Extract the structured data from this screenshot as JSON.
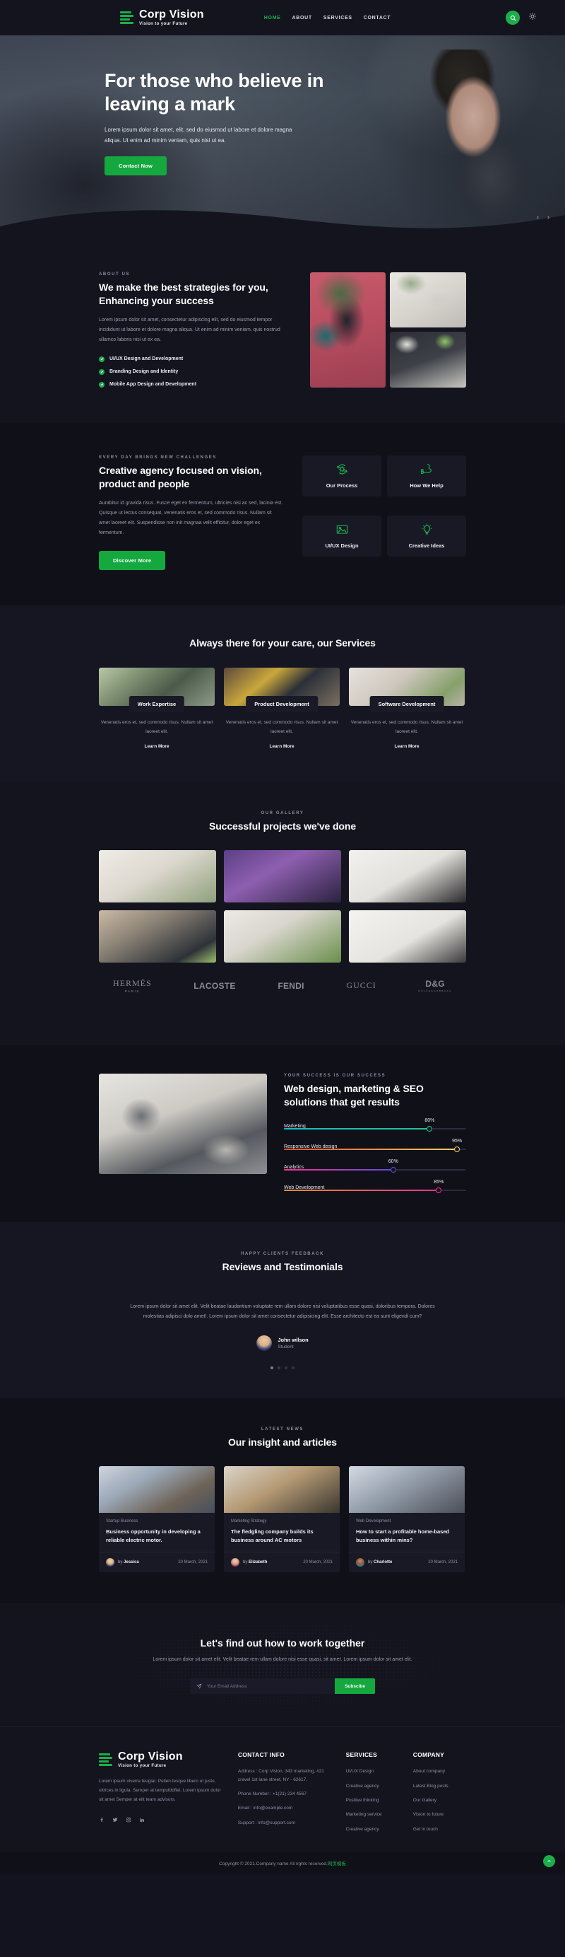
{
  "header": {
    "brand": {
      "name": "Corp Vision",
      "tagline": "Vision to your Future"
    },
    "nav": [
      {
        "label": "HOME",
        "active": true
      },
      {
        "label": "ABOUT",
        "active": false
      },
      {
        "label": "SERVICES",
        "active": false
      },
      {
        "label": "CONTACT",
        "active": false
      }
    ],
    "search_icon": "search-icon",
    "theme_icon": "sun-icon"
  },
  "hero": {
    "title": "For those who believe in leaving a mark",
    "subtitle": "Lorem ipsum dolor sit amet, elit, sed do eiusmod ut labore et dolore magna aliqua. Ut enim ad minim veniam, quis nisi ut ea.",
    "cta": "Contact Now",
    "prev": "‹",
    "next": "›"
  },
  "about": {
    "eyebrow": "ABOUT US",
    "title": "We make the best strategies for you, Enhancing your success",
    "body": "Lorem ipsum dolor sit amet, consectetur adipiscing elit, sed do eiusmod tempor incididunt ut labore et dolore magna aliqua. Ut enim ad minim veniam, quis nostrud ullamco laboris nisi ut ex ea.",
    "checks": [
      "UI/UX Design and Development",
      "Branding Design and Identity",
      "Mobile App Design and Development"
    ]
  },
  "creative": {
    "eyebrow": "EVERY DAY BRINGS NEW CHALLENGES",
    "title": "Creative agency focused on vision, product and people",
    "body": "Aurabitur id gravida risus. Fusce eget ex fermentum, ultricies nisi ac sed, lacinia est. Quisque ut lectus consequat, venenatis eros et, sed commodo risus. Nullam sit amet laoreet elit. Suspendisse non init magnaa velit efficitur, dolor eget ex fermentum.",
    "cta": "Discover More",
    "features": [
      {
        "label": "Our Process",
        "icon": "process-gear-icon"
      },
      {
        "label": "How We Help",
        "icon": "helping-hand-icon"
      },
      {
        "label": "UI/UX Design",
        "icon": "image-icon"
      },
      {
        "label": "Creative Ideas",
        "icon": "lightbulb-icon"
      }
    ]
  },
  "services": {
    "title": "Always there for your care, our Services",
    "items": [
      {
        "label": "Work Expertise",
        "desc": "Venenatis eros et, sed commodo risus. Nullam sit amet laoreet elit.",
        "more": "Learn More"
      },
      {
        "label": "Product Development",
        "desc": "Venenatis eros et, sed commodo risus. Nullam sit amet laoreet elit.",
        "more": "Learn More"
      },
      {
        "label": "Software Development",
        "desc": "Venenatis eros et, sed commodo risus. Nullam sit amet laoreet elit.",
        "more": "Learn More"
      }
    ]
  },
  "gallery": {
    "eyebrow": "OUR GALLERY",
    "title": "Successful projects we've done"
  },
  "logos": [
    {
      "name": "HERMÈS",
      "sub": "PARIS",
      "style": "serif"
    },
    {
      "name": "LACOSTE",
      "sub": "",
      "style": "sans"
    },
    {
      "name": "FENDI",
      "sub": "",
      "style": "sans"
    },
    {
      "name": "GUCCI",
      "sub": "",
      "style": "serif"
    },
    {
      "name": "D&G",
      "sub": "DOLCE&GABBANA",
      "style": "sans"
    }
  ],
  "skills": {
    "eyebrow": "YOUR SUCCESS IS OUR SUCCESS",
    "title": "Web design, marketing & SEO solutions that get results",
    "bars": [
      {
        "label": "Marketing",
        "value": 80,
        "pct": "80%",
        "from": "#18bdc9",
        "to": "#16c79a"
      },
      {
        "label": "Responsive Web design",
        "value": 95,
        "pct": "95%",
        "from": "#e8502a",
        "to": "#f5d06a"
      },
      {
        "label": "Analytics",
        "value": 60,
        "pct": "60%",
        "from": "#ff2d95",
        "to": "#5b4ce0"
      },
      {
        "label": "Web Development",
        "value": 85,
        "pct": "85%",
        "from": "#e8902a",
        "to": "#ff2d95"
      }
    ]
  },
  "testimonials": {
    "eyebrow": "HAPPY CLIENTS FEEDBACK",
    "title": "Reviews and Testimonials",
    "quote": "Lorem ipsum dolor sit amet elit. Velit beatae laudantium voluptate rem ullam dolore nisi voluptatibus esse quasi, doloribus tempora. Dolores molestias adipisci dolo amet!. Lorem ipsum dolor sit amet consectetur adipisicing elit. Esse architecto est ea sunt eligendi cum?",
    "author": "John wilson",
    "role": "Student",
    "dots": 4,
    "active_dot": 0
  },
  "blog": {
    "eyebrow": "LATEST NEWS",
    "title": "Our insight and articles",
    "posts": [
      {
        "category": "Startup Business",
        "title": "Business opportunity in developing a reliable electric motor.",
        "by_prefix": "by",
        "author": "Jessica",
        "date": "20 March, 2021"
      },
      {
        "category": "Marketing Strategy",
        "title": "The fledgling company builds its business around AC motors",
        "by_prefix": "by",
        "author": "Elizabeth",
        "date": "20 March, 2021"
      },
      {
        "category": "Web Development",
        "title": "How to start a profitable home-based business within mins?",
        "by_prefix": "by",
        "author": "Charlotte",
        "date": "20 March, 2021"
      }
    ]
  },
  "newsletter": {
    "title": "Let's find out how to work together",
    "body": "Lorem ipsum dolor sit amet elit. Velit beatae rem ullam dolore nisi esse quasi, sit amet. Lorem ipsum dolor sit amet elit.",
    "placeholder": "Your Email Address",
    "value": "",
    "button": "Subscibe",
    "send_icon": "paper-plane-icon"
  },
  "footer": {
    "brand": {
      "name": "Corp Vision",
      "tagline": "Vision to your Future"
    },
    "about": "Lorem ipsum viverra feugiat. Pellen tesque libero ut justo, ultrices in ligula. Semper at tempufddfiel. Lorem ipsum dolor sit amet Semper at elit team advisors.",
    "socials": [
      "facebook-icon",
      "twitter-icon",
      "instagram-icon",
      "linkedin-icon"
    ],
    "contact": {
      "heading": "CONTACT INFO",
      "lines": [
        "Address : Corp Vision, 343 marketing, #21 cravel 1st lane street, NY - 62617.",
        "Phone Number : +1(21) 234 4567",
        "Email : info@example.com",
        "Support : info@support.com"
      ]
    },
    "services": {
      "heading": "SERVICES",
      "items": [
        "UI/UX Design",
        "Creative agency",
        "Positive thinking",
        "Marketing service",
        "Creative agency"
      ]
    },
    "company": {
      "heading": "COMPANY",
      "items": [
        "About company",
        "Latest Blog posts",
        "Our Gallery",
        "Vision to future",
        "Get in touch"
      ]
    },
    "copyright_text": "Copyright © 2021.Company name All rights reserved.",
    "copyright_link": "网页模板",
    "to_top_icon": "chevron-up-icon"
  }
}
